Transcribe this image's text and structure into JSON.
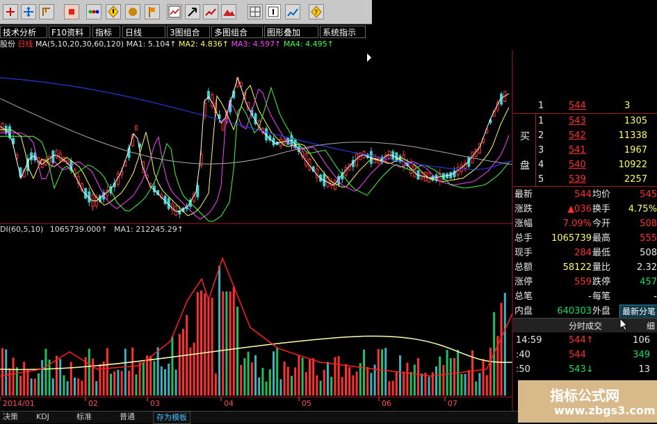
{
  "toolbar": {
    "icons": [
      "add-icon",
      "move-icon",
      "bracket-icon",
      "record-icon",
      "dots-icon",
      "diamond-icon",
      "bell-icon",
      "flag-icon",
      "chart-icon",
      "arrow-icon",
      "grid-icon",
      "info-icon",
      "chart-up-icon",
      "question-icon"
    ]
  },
  "menu": {
    "tabs": [
      "技术分析",
      "F10资料",
      "指标",
      "日线",
      "3图组合",
      "多图组合",
      "图形叠加",
      "系统指示"
    ]
  },
  "ma_line": {
    "prefix": "股份",
    "period": "日线",
    "params": "MA(5,10,20,30,60,120)",
    "ma1": "MA1: 5.104↑",
    "ma2": "MA2: 4.836↑",
    "ma3": "MA3: 4.597↑",
    "ma4": "MA4: 4.495↑"
  },
  "vol_line": {
    "text": "DI(60,5,10)",
    "value": "1065739.000↑",
    "ma1": "MA1: 212245.29↑"
  },
  "order_book": {
    "sell_top": {
      "level": "1",
      "price": "544",
      "volume": "3"
    },
    "buy_label": [
      "买",
      "盘"
    ],
    "buy": [
      {
        "level": "1",
        "price": "543",
        "volume": "1305"
      },
      {
        "level": "2",
        "price": "542",
        "volume": "11338"
      },
      {
        "level": "3",
        "price": "541",
        "volume": "1967"
      },
      {
        "level": "4",
        "price": "540",
        "volume": "10922"
      },
      {
        "level": "5",
        "price": "539",
        "volume": "2257"
      }
    ]
  },
  "quote": [
    {
      "l1": "最新",
      "v1": "544",
      "l2": "均价",
      "v2": "545"
    },
    {
      "l1": "涨跌",
      "v1": "▲036",
      "l2": "换手",
      "v2": "4.75%"
    },
    {
      "l1": "涨幅",
      "v1": "7.09%",
      "l2": "今开",
      "v2": "508"
    },
    {
      "l1": "总手",
      "v1": "1065739",
      "l2": "最高",
      "v2": "555"
    },
    {
      "l1": "现手",
      "v1": "284",
      "l2": "最低",
      "v2": "508"
    },
    {
      "l1": "总额",
      "v1": "58122",
      "l2": "量比",
      "v2": "2.32"
    },
    {
      "l1": "涨停",
      "v1": "559",
      "l2": "跌停",
      "v2": "457"
    },
    {
      "l1": "总笔",
      "v1": "-",
      "l2": "每笔",
      "v2": "-"
    },
    {
      "l1": "内盘",
      "v1": "640303",
      "l2": "外盘",
      "v2": ""
    }
  ],
  "latest_tab": "最新分笔",
  "ticks_header": {
    "title": "分时成交",
    "right": "细"
  },
  "ticks": [
    {
      "time": "14:59",
      "price": "544↑",
      "vol": "106"
    },
    {
      "time": ":40",
      "price": "544",
      "vol": "349"
    },
    {
      "time": ":50",
      "price": "543↓",
      "vol": "13"
    }
  ],
  "x_axis": [
    "2014/01",
    "02",
    "03",
    "04",
    "05",
    "06",
    "07"
  ],
  "bottom_tabs": [
    "决策",
    "KDJ",
    "标准",
    "普通",
    "存为模板"
  ],
  "watermark": {
    "title": "指标公式网",
    "url": "www.zbgs3.com"
  },
  "colors": {
    "up": "#ff3030",
    "down": "#10e060",
    "bg": "#000000",
    "ma1": "#ffffff",
    "ma2": "#ffff60",
    "ma3": "#ff40ff",
    "ma4": "#40ff40"
  }
}
